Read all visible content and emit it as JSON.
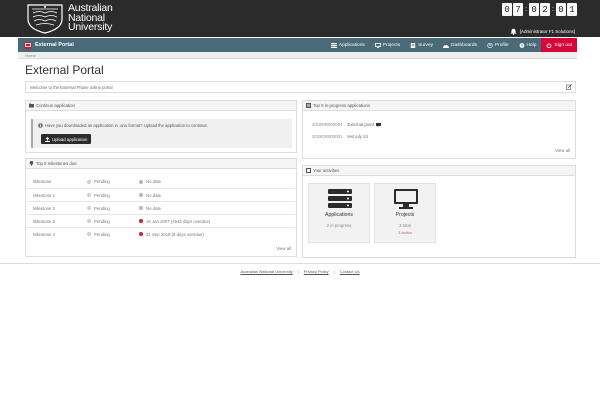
{
  "header": {
    "logo_lines": [
      "Australian",
      "National",
      "University"
    ],
    "clock": [
      "0",
      "7",
      "0",
      "2",
      "0",
      "1"
    ],
    "user": "[Administrator F1 Solutions]"
  },
  "nav": {
    "brand": "External Portal",
    "items": [
      {
        "label": "Applications",
        "icon": "applications-icon"
      },
      {
        "label": "Projects",
        "icon": "projects-icon"
      },
      {
        "label": "Survey",
        "icon": "survey-icon"
      },
      {
        "label": "Dashboards",
        "icon": "dashboards-icon"
      },
      {
        "label": "Profile",
        "icon": "profile-icon"
      },
      {
        "label": "Help",
        "icon": "help-icon"
      }
    ],
    "signout": "Sign out",
    "signout_color": "#d6083b",
    "bar_color": "#4a6a7a"
  },
  "breadcrumb": "Home",
  "page_title": "External Portal",
  "welcome": "Welcome to the External Phase online portal",
  "continue_panel": {
    "title": "Continue application",
    "message": "Have you downloaded an application in .anu format? Upload the application to continue.",
    "button": "Upload application"
  },
  "milestones_panel": {
    "title": "Top 5 milestones due",
    "rows": [
      {
        "name": "Milestone",
        "status": "Pending",
        "date": "No date",
        "overdue": false
      },
      {
        "name": "Milestone 1",
        "status": "Pending",
        "date": "No date",
        "overdue": false
      },
      {
        "name": "Milestone 2",
        "status": "Pending",
        "date": "No date",
        "overdue": false
      },
      {
        "name": "Milestone 3",
        "status": "Pending",
        "date": "16 Jan 2007 (4642 days overdue)",
        "overdue": true
      },
      {
        "name": "Milestone 4",
        "status": "Pending",
        "date": "21 Sep 2019 (5 days overdue)",
        "overdue": true
      }
    ],
    "view_all": "View all"
  },
  "applications_panel": {
    "title": "Top 5 in-progress applications",
    "rows": [
      {
        "id": "2019GR000004",
        "title": "External grant"
      },
      {
        "id": "2019GR000001",
        "title": "test july 24"
      }
    ],
    "view_all": "View all"
  },
  "activities_panel": {
    "title": "Your activities",
    "tiles": [
      {
        "title": "Applications",
        "sub": "2 in progress",
        "warn": ""
      },
      {
        "title": "Projects",
        "sub": "3 total",
        "warn": "3 active"
      }
    ]
  },
  "footer": {
    "links": [
      "Australian National University",
      "Privacy Policy",
      "Contact Us"
    ]
  }
}
